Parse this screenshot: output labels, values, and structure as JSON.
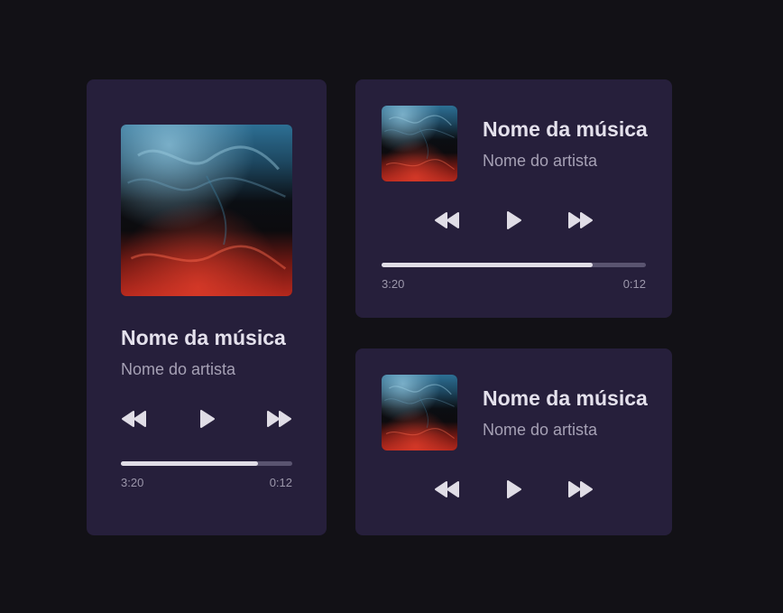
{
  "players": {
    "large": {
      "song_title": "Nome da música",
      "artist": "Nome do artista",
      "progress": 0.8,
      "time_left": "3:20",
      "time_right": "0:12"
    },
    "top": {
      "song_title": "Nome da música",
      "artist": "Nome do artista",
      "progress": 0.8,
      "time_left": "3:20",
      "time_right": "0:12"
    },
    "bottom": {
      "song_title": "Nome da música",
      "artist": "Nome do artista"
    }
  },
  "icons": {
    "rewind": "rewind-icon",
    "play": "play-icon",
    "fast_forward": "fast-forward-icon"
  },
  "colors": {
    "page_background": "#121116",
    "card_background": "#261f3b",
    "title": "#e4e1ec",
    "artist": "#a6a1b5",
    "progress_fill": "#e0dde6",
    "progress_track": "#5a5470"
  }
}
